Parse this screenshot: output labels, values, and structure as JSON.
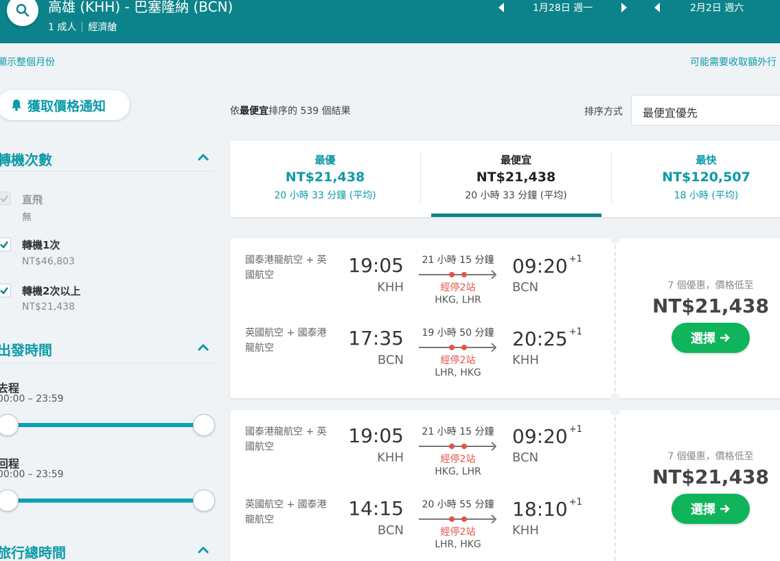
{
  "header": {
    "route": "高雄 (KHH) - 巴塞隆納 (BCN)",
    "passengers": "1 成人",
    "cabin": "經濟艙",
    "outbound_date": "1月28日 週一",
    "return_date": "2月2日 週六"
  },
  "links": {
    "month_view": "顯示整個月份",
    "extra_fees": "可能需要收取額外行"
  },
  "price_alert": {
    "label": "獲取價格通知"
  },
  "filters": {
    "stops": {
      "title": "轉機次數",
      "options": [
        {
          "label": "直飛",
          "sub": "無",
          "checked": false,
          "disabled": true
        },
        {
          "label": "轉機1次",
          "sub": "NT$46,803",
          "checked": true,
          "disabled": false
        },
        {
          "label": "轉機2次以上",
          "sub": "NT$21,438",
          "checked": true,
          "disabled": false
        }
      ]
    },
    "departure": {
      "title": "出發時間",
      "outbound_label": "去程",
      "outbound_range": "00:00 – 23:59",
      "return_label": "回程",
      "return_range": "00:00 – 23:59"
    },
    "duration": {
      "title": "旅行總時間"
    }
  },
  "results": {
    "prefix": "依",
    "sort_key": "最便宜",
    "suffix": "排序的 539 個結果"
  },
  "sort": {
    "label": "排序方式",
    "value": "最便宜優先"
  },
  "summary": [
    {
      "title": "最優",
      "price": "NT$21,438",
      "duration": "20 小時 33 分鐘 (平均)"
    },
    {
      "title": "最便宜",
      "price": "NT$21,438",
      "duration": "20 小時 33 分鐘 (平均)"
    },
    {
      "title": "最快",
      "price": "NT$120,507",
      "duration": "18 小時 (平均)"
    }
  ],
  "flights": [
    {
      "legs": [
        {
          "airline": "國泰港龍航空 + 英國航空",
          "dep_time": "19:05",
          "dep_code": "KHH",
          "duration": "21 小時 15 分鐘",
          "stops": "經停2站",
          "via": "HKG, LHR",
          "arr_time": "09:20",
          "day_offset": "+1",
          "arr_code": "BCN"
        },
        {
          "airline": "英國航空 + 國泰港龍航空",
          "dep_time": "17:35",
          "dep_code": "BCN",
          "duration": "19 小時 50 分鐘",
          "stops": "經停2站",
          "via": "LHR, HKG",
          "arr_time": "20:25",
          "day_offset": "+1",
          "arr_code": "KHH"
        }
      ],
      "deals": "7 個優惠，價格低至",
      "price": "NT$21,438",
      "select_label": "選擇"
    },
    {
      "legs": [
        {
          "airline": "國泰港龍航空 + 英國航空",
          "dep_time": "19:05",
          "dep_code": "KHH",
          "duration": "21 小時 15 分鐘",
          "stops": "經停2站",
          "via": "HKG, LHR",
          "arr_time": "09:20",
          "day_offset": "+1",
          "arr_code": "BCN"
        },
        {
          "airline": "英國航空 + 國泰港龍航空",
          "dep_time": "14:15",
          "dep_code": "BCN",
          "duration": "20 小時 55 分鐘",
          "stops": "經停2站",
          "via": "LHR, HKG",
          "arr_time": "18:10",
          "day_offset": "+1",
          "arr_code": "KHH"
        }
      ],
      "deals": "7 個優惠，價格低至",
      "price": "NT$21,438",
      "select_label": "選擇"
    }
  ],
  "colors": {
    "header_bg": "#0c838a",
    "accent": "#0c9aa8",
    "select_button": "#10b45b",
    "stops_red": "#e5534b"
  },
  "icons": [
    "search-icon",
    "chevron-left-icon",
    "chevron-right-icon",
    "bell-icon",
    "chevron-up-icon",
    "check-icon",
    "plane-icon",
    "arrow-right-icon"
  ]
}
